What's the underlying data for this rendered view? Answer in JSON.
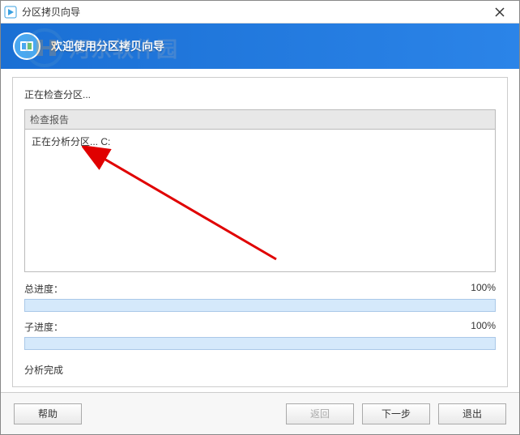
{
  "window": {
    "title": "分区拷贝向导"
  },
  "header": {
    "title": "欢迎使用分区拷贝向导"
  },
  "watermark": {
    "text": "河东软件园"
  },
  "content": {
    "status": "正在检查分区...",
    "report_header": "检查报告",
    "report_line1": "正在分析分区... C:",
    "total_label": "总进度：",
    "total_percent": "100%",
    "sub_label": "子进度：",
    "sub_percent": "100%",
    "finish": "分析完成"
  },
  "buttons": {
    "help": "帮助",
    "back": "返回",
    "next": "下一步",
    "exit": "退出"
  }
}
